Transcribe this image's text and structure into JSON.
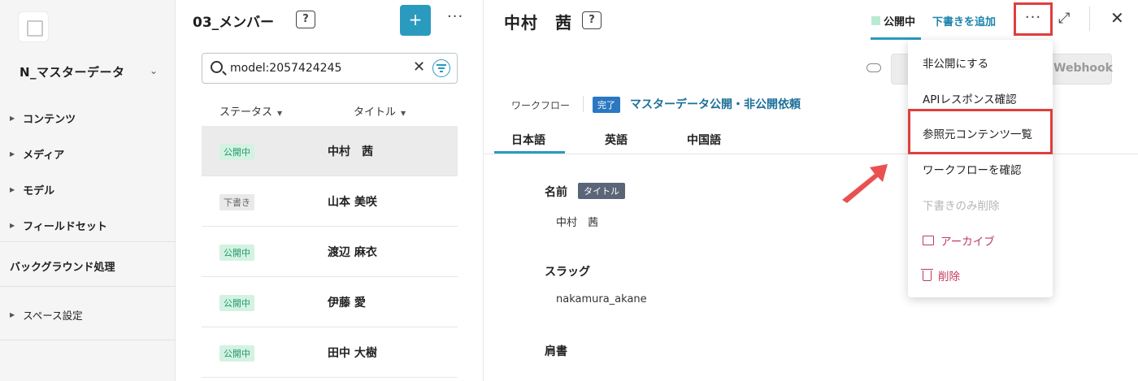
{
  "sidebar": {
    "service_name": "N_マスターデータ",
    "items": [
      {
        "label": "コンテンツ"
      },
      {
        "label": "メディア"
      },
      {
        "label": "モデル"
      },
      {
        "label": "フィールドセット"
      }
    ],
    "background_label": "バックグラウンド処理",
    "space_settings": "スペース設定"
  },
  "list": {
    "title": "03_メンバー",
    "add_label": "+",
    "more_label": "···",
    "search_value": "model:2057424245",
    "columns": [
      "ステータス",
      "タイトル"
    ],
    "rows": [
      {
        "status": "公開中",
        "status_type": "published",
        "title": "中村　茜",
        "selected": true
      },
      {
        "status": "下書き",
        "status_type": "draft",
        "title": "山本 美咲"
      },
      {
        "status": "公開中",
        "status_type": "published",
        "title": "渡辺 麻衣"
      },
      {
        "status": "公開中",
        "status_type": "published",
        "title": "伊藤 愛"
      },
      {
        "status": "公開中",
        "status_type": "published",
        "title": "田中 大樹"
      }
    ]
  },
  "detail": {
    "title": "中村　茜",
    "status": "公開中",
    "add_draft": "下書きを追加",
    "more_label": "···",
    "webhook_label": "Webhook",
    "workflow": {
      "label": "ワークフロー",
      "badge": "完了",
      "name": "マスターデータ公開・非公開依頼"
    },
    "lang_tabs": [
      "日本語",
      "英語",
      "中国語"
    ],
    "fields": {
      "name_label": "名前",
      "name_tag": "タイトル",
      "name_value": "中村　茜",
      "slug_label": "スラッグ",
      "slug_value": "nakamura_akane",
      "position_label": "肩書"
    }
  },
  "menu": {
    "items": [
      {
        "label": "非公開にする",
        "state": "normal"
      },
      {
        "label": "APIレスポンス確認",
        "state": "normal"
      },
      {
        "label": "参照元コンテンツ一覧",
        "state": "highlighted"
      },
      {
        "label": "ワークフローを確認",
        "state": "normal"
      },
      {
        "label": "下書きのみ削除",
        "state": "disabled"
      },
      {
        "label": "アーカイブ",
        "state": "danger",
        "icon": "archive-icon"
      },
      {
        "label": "削除",
        "state": "danger",
        "icon": "trash-icon"
      }
    ]
  },
  "colors": {
    "accent": "#2b9abf",
    "highlight": "#e03e3e",
    "published_bg": "#d4f2e2",
    "danger": "#c03a5c"
  }
}
